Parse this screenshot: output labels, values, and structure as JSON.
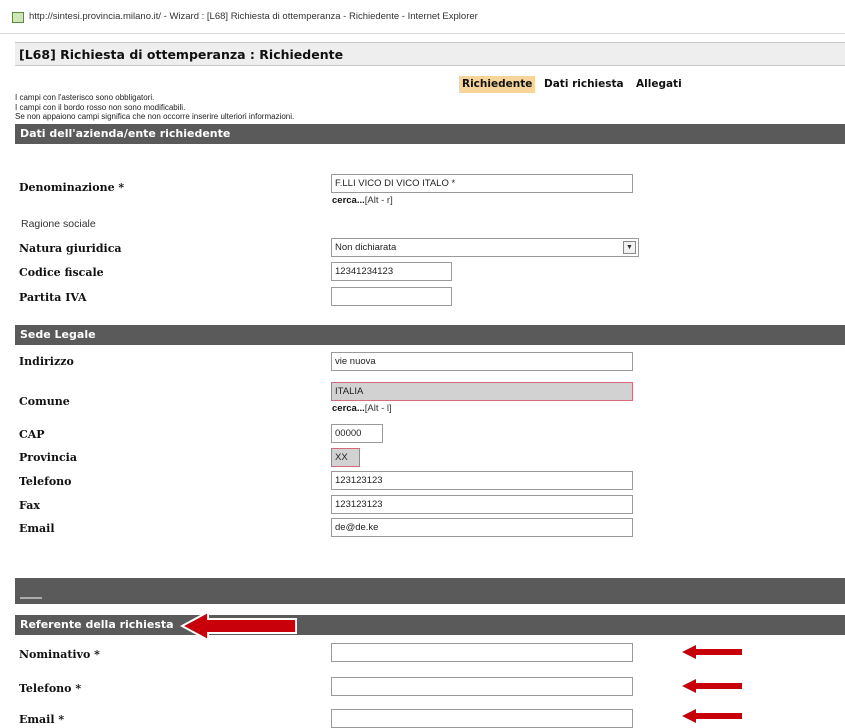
{
  "window": {
    "title": "http://sintesi.provincia.milano.it/ - Wizard : [L68] Richiesta di ottemperanza - Richiedente - Internet Explorer"
  },
  "page": {
    "title": "[L68] Richiesta di ottemperanza : Richiedente"
  },
  "tabs": [
    {
      "label": "Richiedente",
      "active": true
    },
    {
      "label": "Dati richiesta",
      "active": false
    },
    {
      "label": "Allegati",
      "active": false
    }
  ],
  "notes": [
    "I campi con l'asterisco sono obbligatori.",
    "I campi con il bordo rosso non sono modificabili.",
    "Se non appaiono campi significa che non occorre inserire ulteriori informazioni."
  ],
  "sections": {
    "azienda": "Dati dell'azienda/ente richiedente",
    "sede_legale": "Sede Legale",
    "blank": "____",
    "referente": "Referente della richiesta"
  },
  "azienda": {
    "denominazione": {
      "label": "Denominazione *",
      "value": "F.LLI VICO DI VICO ITALO *"
    },
    "cerca1": {
      "link": "cerca...",
      "shortcut": "[Alt - r]"
    },
    "ragione_sociale": {
      "label": "Ragione sociale"
    },
    "natura_giuridica": {
      "label": "Natura giuridica",
      "value": "Non dichiarata"
    },
    "codice_fiscale": {
      "label": "Codice fiscale",
      "value": "12341234123"
    },
    "partita_iva": {
      "label": "Partita IVA",
      "value": ""
    }
  },
  "sede": {
    "indirizzo": {
      "label": "Indirizzo",
      "value": "vie nuova"
    },
    "comune": {
      "label": "Comune",
      "value": "ITALIA"
    },
    "cerca2": {
      "link": "cerca...",
      "shortcut": "[Alt - l]"
    },
    "cap": {
      "label": "CAP",
      "value": "00000"
    },
    "provincia": {
      "label": "Provincia",
      "value": "XX"
    },
    "telefono": {
      "label": "Telefono",
      "value": "123123123"
    },
    "fax": {
      "label": "Fax",
      "value": "123123123"
    },
    "email": {
      "label": "Email",
      "value": "de@de.ke"
    }
  },
  "referente": {
    "nominativo": {
      "label": "Nominativo *",
      "value": ""
    },
    "telefono": {
      "label": "Telefono *",
      "value": ""
    },
    "email": {
      "label": "Email *",
      "value": ""
    }
  },
  "colors": {
    "section_bg": "#5a5a5a",
    "active_tab": "#f6d49a",
    "readonly_border": "#d46a7a",
    "annotation_arrow": "#c8000a"
  }
}
